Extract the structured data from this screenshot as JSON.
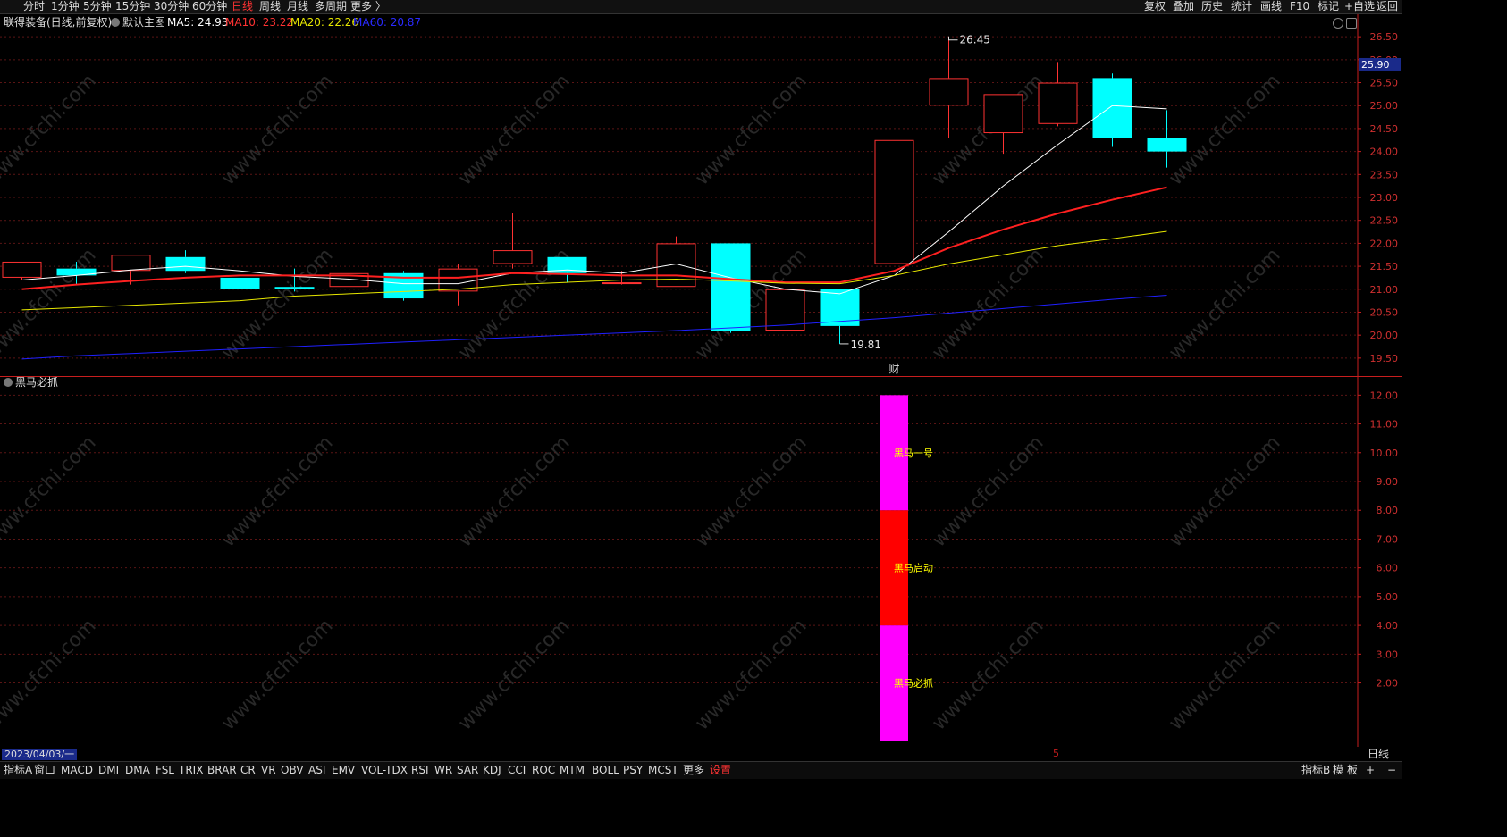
{
  "toolbar": {
    "periods": [
      {
        "label": "分时"
      },
      {
        "label": "1分钟"
      },
      {
        "label": "5分钟"
      },
      {
        "label": "15分钟"
      },
      {
        "label": "30分钟"
      },
      {
        "label": "60分钟"
      },
      {
        "label": "日线"
      },
      {
        "label": "周线"
      },
      {
        "label": "月线"
      },
      {
        "label": "多周期"
      },
      {
        "label": "更多 〉"
      }
    ],
    "active_period": "日线",
    "right_tools": [
      {
        "label": "复权"
      },
      {
        "label": "叠加"
      },
      {
        "label": "历史"
      },
      {
        "label": "统计"
      },
      {
        "label": "画线"
      },
      {
        "label": "F10"
      },
      {
        "label": "标记"
      },
      {
        "label": "+自选"
      },
      {
        "label": "返回"
      }
    ]
  },
  "info": {
    "stock": "联得装备(日线,前复权)",
    "main_chart": "默认主图",
    "ma5": "MA5: 24.93",
    "ma10": "MA10: 23.22",
    "ma20": "MA20: 22.26",
    "ma60": "MA60: 20.87"
  },
  "colors": {
    "up": "#ff3232",
    "down": "#00ffff",
    "ma5": "#ffffff",
    "ma10": "#ff2020",
    "ma20": "#e6e600",
    "ma60": "#2020ff",
    "magenta": "#ff00ff",
    "red_bar": "#ff0000",
    "bar_text": "#ffff00",
    "axis": "#c81e1e"
  },
  "chart_data": [
    {
      "type": "candlestick",
      "title": "联得装备(日线,前复权)",
      "y_ticks": [
        "26.50",
        "26.00",
        "25.50",
        "25.00",
        "24.50",
        "24.00",
        "23.50",
        "23.00",
        "22.50",
        "22.00",
        "21.50",
        "21.00",
        "20.50",
        "20.00",
        "19.50"
      ],
      "ylim": [
        19.4,
        26.6
      ],
      "current_price": "25.90",
      "ohlc": [
        {
          "o": 21.25,
          "h": 21.6,
          "l": 21.2,
          "c": 21.6
        },
        {
          "o": 21.45,
          "h": 21.6,
          "l": 21.1,
          "c": 21.3
        },
        {
          "o": 21.4,
          "h": 21.75,
          "l": 21.1,
          "c": 21.75
        },
        {
          "o": 21.7,
          "h": 21.85,
          "l": 21.35,
          "c": 21.4
        },
        {
          "o": 21.25,
          "h": 21.55,
          "l": 20.85,
          "c": 21.0
        },
        {
          "o": 21.05,
          "h": 21.45,
          "l": 20.95,
          "c": 21.0
        },
        {
          "o": 21.05,
          "h": 21.4,
          "l": 20.95,
          "c": 21.35
        },
        {
          "o": 21.35,
          "h": 21.4,
          "l": 20.75,
          "c": 20.8
        },
        {
          "o": 20.95,
          "h": 21.55,
          "l": 20.65,
          "c": 21.45
        },
        {
          "o": 21.55,
          "h": 22.65,
          "l": 21.45,
          "c": 21.85
        },
        {
          "o": 21.7,
          "h": 21.7,
          "l": 21.15,
          "c": 21.35
        },
        {
          "o": 21.15,
          "h": 21.4,
          "l": 21.1,
          "c": 21.15
        },
        {
          "o": 21.05,
          "h": 22.15,
          "l": 21.05,
          "c": 22.0
        },
        {
          "o": 22.0,
          "h": 22.0,
          "l": 20.05,
          "c": 20.1
        },
        {
          "o": 20.1,
          "h": 21.0,
          "l": 20.1,
          "c": 21.0
        },
        {
          "o": 21.0,
          "h": 21.0,
          "l": 19.81,
          "c": 20.2
        },
        {
          "o": 21.55,
          "h": 24.25,
          "l": 21.55,
          "c": 24.25
        },
        {
          "o": 25.0,
          "h": 26.45,
          "l": 24.3,
          "c": 25.6
        },
        {
          "o": 24.4,
          "h": 25.25,
          "l": 23.95,
          "c": 25.25
        },
        {
          "o": 24.6,
          "h": 25.95,
          "l": 24.55,
          "c": 25.5
        },
        {
          "o": 25.6,
          "h": 25.7,
          "l": 24.1,
          "c": 24.3
        },
        {
          "o": 24.3,
          "h": 24.9,
          "l": 23.65,
          "c": 24.0
        }
      ],
      "ma": [
        {
          "name": "MA5",
          "values": [
            21.2,
            21.3,
            21.42,
            21.5,
            21.4,
            21.28,
            21.22,
            21.12,
            21.12,
            21.35,
            21.42,
            21.35,
            21.55,
            21.25,
            21.0,
            20.9,
            21.3,
            22.25,
            23.25,
            24.15,
            25.0,
            24.93
          ]
        },
        {
          "name": "MA10",
          "values": [
            21.0,
            21.1,
            21.18,
            21.25,
            21.3,
            21.3,
            21.3,
            21.25,
            21.25,
            21.35,
            21.33,
            21.3,
            21.3,
            21.22,
            21.15,
            21.15,
            21.4,
            21.9,
            22.3,
            22.65,
            22.95,
            23.22
          ]
        },
        {
          "name": "MA20",
          "values": [
            20.55,
            20.6,
            20.65,
            20.7,
            20.75,
            20.85,
            20.9,
            20.95,
            21.0,
            21.1,
            21.15,
            21.2,
            21.22,
            21.18,
            21.13,
            21.12,
            21.3,
            21.55,
            21.75,
            21.95,
            22.1,
            22.26
          ]
        },
        {
          "name": "MA60",
          "values": [
            19.48,
            19.55,
            19.6,
            19.65,
            19.7,
            19.75,
            19.8,
            19.85,
            19.9,
            19.95,
            20.0,
            20.05,
            20.1,
            20.16,
            20.22,
            20.3,
            20.38,
            20.48,
            20.58,
            20.68,
            20.78,
            20.87
          ]
        }
      ],
      "annotations": [
        {
          "label": "26.45"
        },
        {
          "label": "19.81"
        },
        {
          "label": "财"
        }
      ]
    },
    {
      "type": "bar",
      "title": "黑马必抓",
      "y_ticks": [
        "12.00",
        "11.00",
        "10.00",
        "9.00",
        "8.00",
        "7.00",
        "6.00",
        "5.00",
        "4.00",
        "3.00",
        "2.00"
      ],
      "ylim": [
        0.0,
        12.6
      ],
      "category_index": 16,
      "segments": [
        {
          "name": "黑马必抓",
          "from": 0,
          "to": 4,
          "color": "#ff00ff"
        },
        {
          "name": "黑马启动",
          "from": 4,
          "to": 8,
          "color": "#ff0000"
        },
        {
          "name": "黑马一号",
          "from": 8,
          "to": 12,
          "color": "#ff00ff"
        }
      ]
    }
  ],
  "status": {
    "date": "2023/04/03/一",
    "marker": "5",
    "period": "日线"
  },
  "tabs": [
    {
      "label": "指标A"
    },
    {
      "label": "窗口"
    },
    {
      "label": "MACD"
    },
    {
      "label": "DMI"
    },
    {
      "label": "DMA"
    },
    {
      "label": "FSL"
    },
    {
      "label": "TRIX"
    },
    {
      "label": "BRAR"
    },
    {
      "label": "CR"
    },
    {
      "label": "VR"
    },
    {
      "label": "OBV"
    },
    {
      "label": "ASI"
    },
    {
      "label": "EMV"
    },
    {
      "label": "VOL-TDX"
    },
    {
      "label": "RSI"
    },
    {
      "label": "WR"
    },
    {
      "label": "SAR"
    },
    {
      "label": "KDJ"
    },
    {
      "label": "CCI"
    },
    {
      "label": "ROC"
    },
    {
      "label": "MTM"
    },
    {
      "label": "BOLL"
    },
    {
      "label": "PSY"
    },
    {
      "label": "MCST"
    },
    {
      "label": "更多"
    },
    {
      "label": "设置"
    }
  ],
  "tabs_right": [
    {
      "label": "指标B"
    },
    {
      "label": "模"
    },
    {
      "label": "板"
    },
    {
      "label": "+"
    },
    {
      "label": "−"
    }
  ]
}
